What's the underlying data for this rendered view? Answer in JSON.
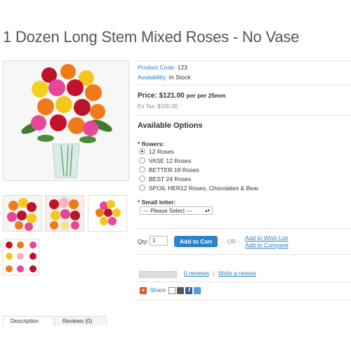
{
  "product": {
    "title": "1 Dozen Long Stem Mixed Roses - No Vase",
    "code_label": "Product Code:",
    "code_value": "123",
    "availability_label": "Availability:",
    "availability_value": "In Stock",
    "price_label": "Price:",
    "price_value": "$121.00",
    "price_unit": "per per 25mm",
    "ex_tax": "Ex Tax: $100.00"
  },
  "options": {
    "heading": "Available Options",
    "flowers_label": "flowers:",
    "flower_choices": [
      "12 Roses",
      "VASE 12 Roses",
      "BETTER 18 Roses",
      "BEST 24 Roses",
      "SPOIL HER12 Roses, Chocolates & Bear"
    ],
    "selected_index": 0,
    "small_letter_label": "Small letter:",
    "small_letter_select": "--- Please Select ---"
  },
  "cart": {
    "qty_label": "Qty:",
    "qty_value": "1",
    "add_to_cart": "Add to Cart",
    "or_text": "- OR -",
    "wishlist": "Add to Wish List",
    "compare": "Add to Compare"
  },
  "reviews": {
    "count_text": "0 reviews",
    "separator": "|",
    "write": "Write a review",
    "rating": 0,
    "max_rating": 5
  },
  "share": {
    "label": "Share"
  },
  "tabs": [
    "Description",
    "Reviews (0)"
  ],
  "colors": {
    "accent": "#2d82c9",
    "link": "#2a7fc1",
    "required": "#cc0000",
    "share_orange": "#e8572a"
  }
}
